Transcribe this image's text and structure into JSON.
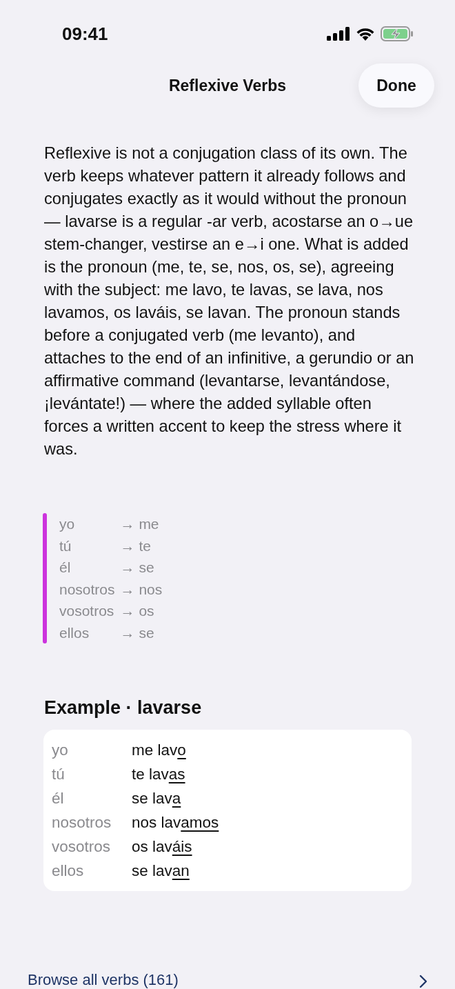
{
  "status_bar": {
    "time": "09:41"
  },
  "nav": {
    "title": "Reflexive Verbs",
    "done_button": "Done"
  },
  "paragraph": "Reflexive is not a conjugation class of its own. The verb keeps whatever pattern it already follows and conjugates exactly as it would without the pronoun — lavarse is a regular -ar verb, acostarse an o→ue stem-changer, vestirse an e→i one. What is added is the pronoun (me, te, se, nos, os, se), agreeing with the subject: me lavo, te lavas, se lava, nos lavamos, os laváis, se lavan. The pronoun stands before a conjugated verb (me levanto), and attaches to the end of an infinitive, a gerundio or an affirmative command (levantarse, levantándose, ¡levántate!) — where the added syllable often forces a written accent to keep the stress where it was.",
  "pronoun_table": {
    "rows": [
      {
        "subject": "yo",
        "pronoun": "→ me"
      },
      {
        "subject": "tú",
        "pronoun": "→ te"
      },
      {
        "subject": "él",
        "pronoun": "→ se"
      },
      {
        "subject": "nosotros",
        "pronoun": "→ nos"
      },
      {
        "subject": "vosotros",
        "pronoun": "→ os"
      },
      {
        "subject": "ellos",
        "pronoun": "→ se"
      }
    ]
  },
  "example": {
    "heading": "Example · lavarse",
    "rows": [
      {
        "subject": "yo",
        "stem": "me lav",
        "ending": "o"
      },
      {
        "subject": "tú",
        "stem": "te lav",
        "ending": "as"
      },
      {
        "subject": "él",
        "stem": "se lav",
        "ending": "a"
      },
      {
        "subject": "nosotros",
        "stem": "nos lav",
        "ending": "amos"
      },
      {
        "subject": "vosotros",
        "stem": "os lav",
        "ending": "áis"
      },
      {
        "subject": "ellos",
        "stem": "se lav",
        "ending": "an"
      }
    ]
  },
  "browse_link": {
    "label": "Browse all verbs (161)"
  }
}
